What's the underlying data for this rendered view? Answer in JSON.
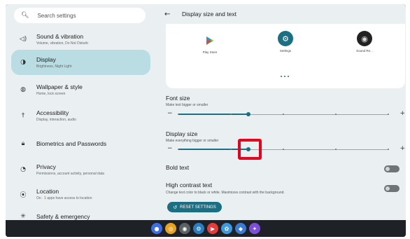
{
  "search": {
    "placeholder": "Search settings",
    "icon": "search-icon"
  },
  "sidebar": {
    "items": [
      {
        "title": "Sound & vibration",
        "subtitle": "Volume, vibration, Do Not Disturb",
        "icon": "speaker-icon"
      },
      {
        "title": "Display",
        "subtitle": "Brightness, Night Light",
        "icon": "brightness-icon",
        "active": true
      },
      {
        "title": "Wallpaper & style",
        "subtitle": "Home, lock screen",
        "icon": "palette-icon"
      },
      {
        "title": "Accessibility",
        "subtitle": "Display, interaction, audio",
        "icon": "accessibility-icon"
      },
      {
        "title": "Biometrics and Passwords",
        "subtitle": "",
        "icon": "lock-icon"
      },
      {
        "title": "Privacy",
        "subtitle": "Permissions, account activity, personal data",
        "icon": "privacy-icon"
      },
      {
        "title": "Location",
        "subtitle": "On · 1 apps have access to location",
        "icon": "location-icon"
      },
      {
        "title": "Safety & emergency",
        "subtitle": "",
        "icon": "emergency-icon"
      }
    ]
  },
  "header": {
    "title": "Display size and text"
  },
  "preview": {
    "apps": [
      {
        "label": "Play Store",
        "icon": "play-store-icon"
      },
      {
        "label": "Settings",
        "icon": "settings-gear-icon"
      },
      {
        "label": "Sound Re...",
        "icon": "sound-recorder-icon"
      }
    ]
  },
  "font_size": {
    "title": "Font size",
    "subtitle": "Make text bigger or smaller",
    "level": 0.333,
    "steps": 4,
    "minus": "−",
    "plus": "+"
  },
  "display_size": {
    "title": "Display size",
    "subtitle": "Make everything bigger or smaller",
    "level": 0.333,
    "steps": 4,
    "minus": "−",
    "plus": "+"
  },
  "bold_text": {
    "title": "Bold text",
    "on": false
  },
  "high_contrast": {
    "title": "High contrast text",
    "subtitle": "Change text color to black or white. Maximizes contrast with the background.",
    "on": false
  },
  "reset_button": {
    "label": "RESET SETTINGS",
    "icon": "reset-icon"
  },
  "colors": {
    "accent": "#1b6f82",
    "active_nav": "#b9dde3",
    "highlight": "#e8001c"
  },
  "taskbar": {
    "apps": [
      {
        "name": "assistant-icon",
        "color": "#3b6ee8",
        "glyph": "●"
      },
      {
        "name": "chrome-icon",
        "color": "#e8a320",
        "glyph": "◎"
      },
      {
        "name": "camera-icon",
        "color": "#5c6166",
        "glyph": "◉"
      },
      {
        "name": "settings-icon",
        "color": "#2a7fc0",
        "glyph": "⚙"
      },
      {
        "name": "media-icon",
        "color": "#e53b3b",
        "glyph": "▶"
      },
      {
        "name": "photos-icon",
        "color": "#3c9ae0",
        "glyph": "✿"
      },
      {
        "name": "messages-icon",
        "color": "#3a7bd5",
        "glyph": "◆"
      },
      {
        "name": "apps-icon",
        "color": "#7b4fd8",
        "glyph": "✦"
      }
    ]
  }
}
